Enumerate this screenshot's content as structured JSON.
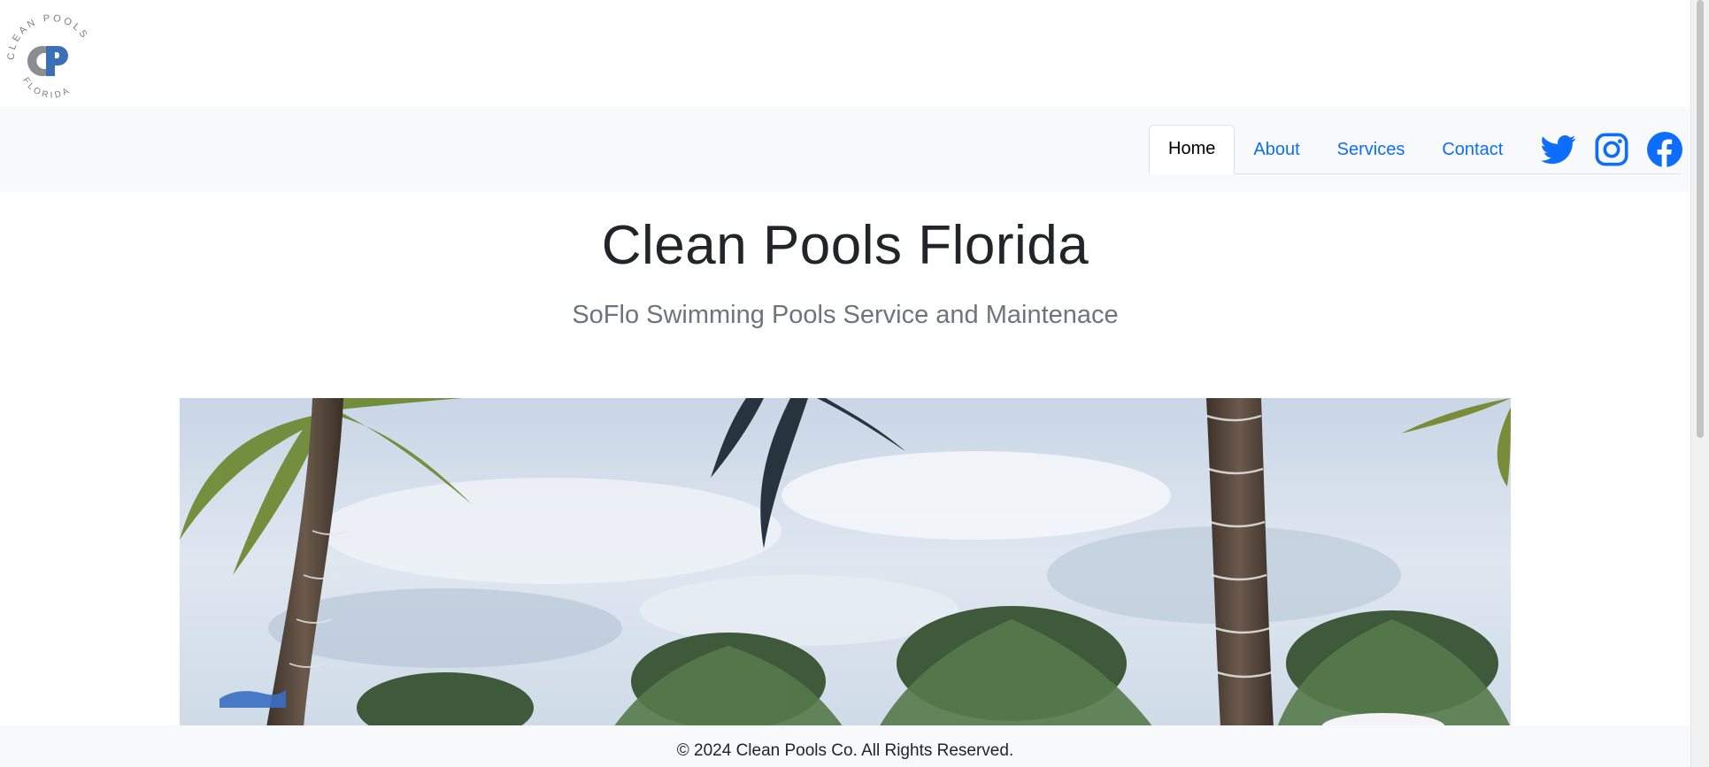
{
  "brand": {
    "logo_top_text": "CLEAN POOLS",
    "logo_bottom_text": "FLORIDA",
    "logo_monogram": "CP",
    "logo_alt": "Clean Pools Florida logo"
  },
  "nav": {
    "items": [
      {
        "label": "Home",
        "active": true
      },
      {
        "label": "About",
        "active": false
      },
      {
        "label": "Services",
        "active": false
      },
      {
        "label": "Contact",
        "active": false
      }
    ],
    "social": [
      "twitter-icon",
      "instagram-icon",
      "facebook-icon"
    ]
  },
  "hero": {
    "title": "Clean Pools Florida",
    "subtitle": "SoFlo Swimming Pools Service and Maintenace"
  },
  "footer": {
    "copyright": "© 2024 Clean Pools Co. All Rights Reserved."
  },
  "colors": {
    "link": "#0d6efd",
    "nav_bg": "#f8f9fa",
    "subtitle": "#6c757d",
    "logo_blue": "#3b6fb6",
    "logo_gray": "#8a8d91"
  }
}
